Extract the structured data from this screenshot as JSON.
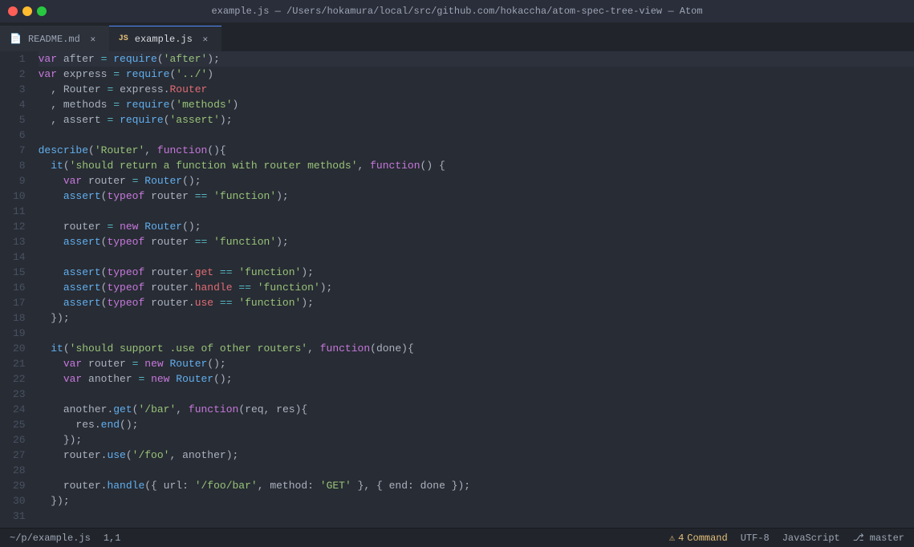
{
  "titlebar": {
    "title": "example.js — /Users/hokamura/local/src/github.com/hokaccha/atom-spec-tree-view — Atom"
  },
  "tabs": [
    {
      "id": "readme",
      "icon": "📄",
      "icon_type": "readme",
      "label": "README.md",
      "active": false
    },
    {
      "id": "example",
      "icon": "JS",
      "icon_type": "js",
      "label": "example.js",
      "active": true
    }
  ],
  "statusbar": {
    "filepath": "~/p/example.js",
    "cursor": "1,1",
    "warning_count": "4",
    "warning_label": "Command",
    "encoding": "UTF-8",
    "language": "JavaScript",
    "branch_icon": "⎇",
    "branch": "master"
  },
  "lines": [
    "1",
    "2",
    "3",
    "4",
    "5",
    "6",
    "7",
    "8",
    "9",
    "10",
    "11",
    "12",
    "13",
    "14",
    "15",
    "16",
    "17",
    "18",
    "19",
    "20",
    "21",
    "22",
    "23",
    "24",
    "25",
    "26",
    "27",
    "28",
    "29",
    "30",
    "31"
  ]
}
